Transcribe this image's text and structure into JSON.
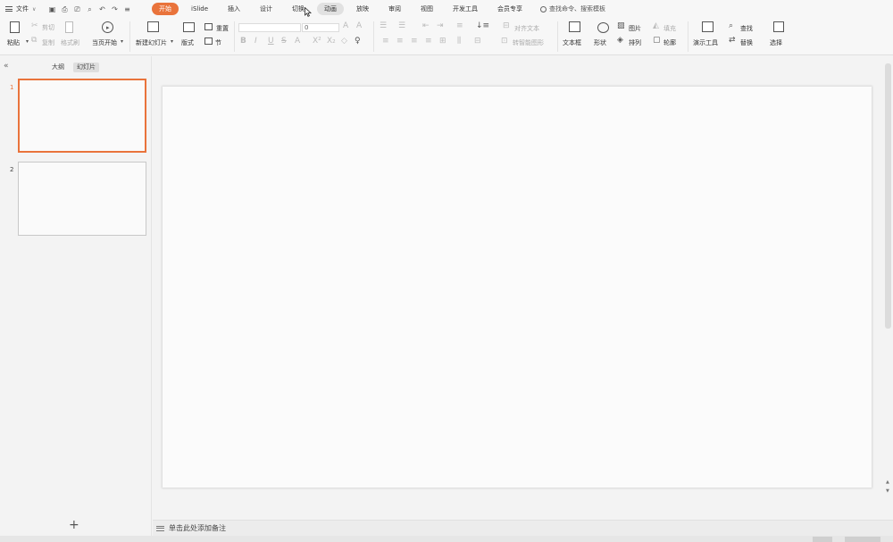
{
  "menubar": {
    "file_label": "文件",
    "tabs": [
      {
        "label": "开始",
        "state": "active"
      },
      {
        "label": "iSlide",
        "state": "normal"
      },
      {
        "label": "插入",
        "state": "normal"
      },
      {
        "label": "设计",
        "state": "normal"
      },
      {
        "label": "切换",
        "state": "normal"
      },
      {
        "label": "动画",
        "state": "hover"
      },
      {
        "label": "放映",
        "state": "normal"
      },
      {
        "label": "审阅",
        "state": "normal"
      },
      {
        "label": "视图",
        "state": "normal"
      },
      {
        "label": "开发工具",
        "state": "normal"
      },
      {
        "label": "会员专享",
        "state": "normal"
      }
    ],
    "search_label": "查找命令、搜索模板"
  },
  "ribbon": {
    "paste": "粘贴",
    "cut": "剪切",
    "copy": "复制",
    "format_painter": "格式刷",
    "play_from_start": "当页开始",
    "new_slide": "新建幻灯片",
    "layout": "版式",
    "section": "节",
    "reset": "重置",
    "font_size": "0",
    "align_text": "对齐文本",
    "smart_shape": "转智能图形",
    "textbox": "文本框",
    "shapes": "形状",
    "picture": "图片",
    "arrange": "排列",
    "fill": "填充",
    "outline": "轮廓",
    "presentation_tools": "演示工具",
    "find": "查找",
    "replace": "替换",
    "select": "选择"
  },
  "left_panel": {
    "tabs": [
      {
        "label": "大纲",
        "state": "normal"
      },
      {
        "label": "幻灯片",
        "state": "active"
      }
    ],
    "slides": [
      {
        "number": "1",
        "selected": true
      },
      {
        "number": "2",
        "selected": false
      }
    ]
  },
  "notes": {
    "placeholder": "单击此处添加备注"
  },
  "colors": {
    "accent": "#e9733b"
  }
}
